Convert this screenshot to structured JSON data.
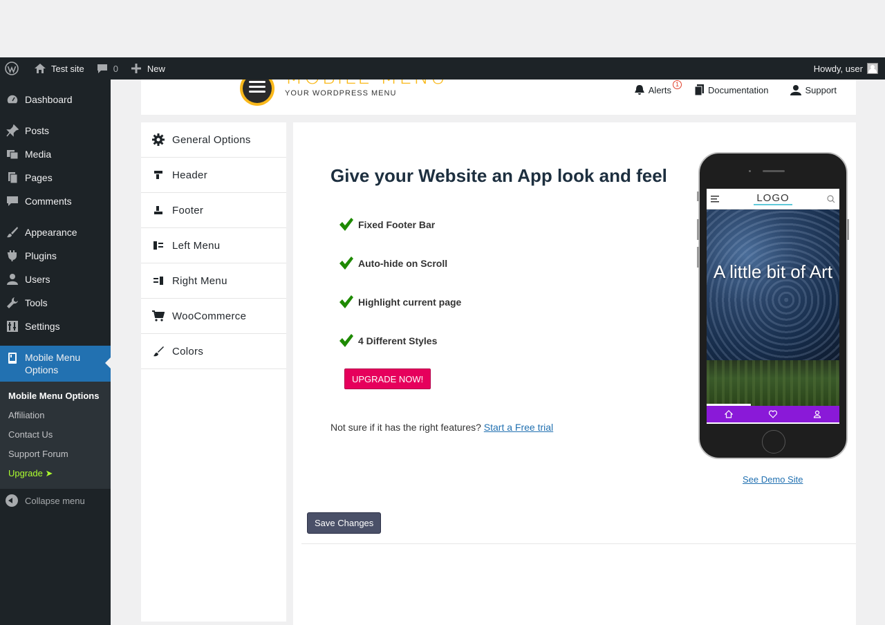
{
  "adminbar": {
    "site_name": "Test site",
    "comments_count": "0",
    "new_label": "New",
    "howdy": "Howdy, user"
  },
  "sidebar": {
    "items": [
      {
        "label": "Dashboard",
        "icon": "dashboard-icon"
      },
      {
        "label": "Posts",
        "icon": "pin-icon"
      },
      {
        "label": "Media",
        "icon": "media-icon"
      },
      {
        "label": "Pages",
        "icon": "pages-icon"
      },
      {
        "label": "Comments",
        "icon": "comment-icon"
      },
      {
        "label": "Appearance",
        "icon": "brush-icon"
      },
      {
        "label": "Plugins",
        "icon": "plugin-icon"
      },
      {
        "label": "Users",
        "icon": "user-icon"
      },
      {
        "label": "Tools",
        "icon": "wrench-icon"
      },
      {
        "label": "Settings",
        "icon": "settings-icon"
      },
      {
        "label": "Mobile Menu Options",
        "icon": "mobile-icon"
      }
    ],
    "submenu": [
      "Mobile Menu Options",
      "Affiliation",
      "Contact Us",
      "Support Forum",
      "Upgrade ➤"
    ],
    "collapse": "Collapse menu"
  },
  "header": {
    "logo_text": "MOBILE MENU",
    "logo_sub": "YOUR WORDPRESS MENU",
    "alerts": "Alerts",
    "alerts_count": "1",
    "documentation": "Documentation",
    "support": "Support"
  },
  "options": [
    {
      "label": "General Options",
      "icon": "gear-icon"
    },
    {
      "label": "Header",
      "icon": "header-icon"
    },
    {
      "label": "Footer",
      "icon": "footer-icon"
    },
    {
      "label": "Left Menu",
      "icon": "left-menu-icon"
    },
    {
      "label": "Right Menu",
      "icon": "right-menu-icon"
    },
    {
      "label": "WooCommerce",
      "icon": "cart-icon"
    },
    {
      "label": "Colors",
      "icon": "paintbrush-icon"
    }
  ],
  "main": {
    "headline": "Give your Website an App look and feel",
    "features": [
      "Fixed Footer Bar",
      "Auto-hide on Scroll",
      "Highlight current page",
      "4 Different Styles"
    ],
    "upgrade_button": "UPGRADE NOW!",
    "trial_text": "Not sure if it has the right features?",
    "trial_link": "Start a Free trial",
    "demo_link": "See Demo Site",
    "save_button": "Save Changes"
  },
  "phone": {
    "logo": "LOGO",
    "hero_text": "A little bit of Art"
  },
  "colors": {
    "accent_blue": "#2271b1",
    "upgrade_pink": "#e6005c",
    "check_green": "#1e8a00",
    "footer_purple": "#8a19d8",
    "logo_yellow": "#f9b81b"
  }
}
